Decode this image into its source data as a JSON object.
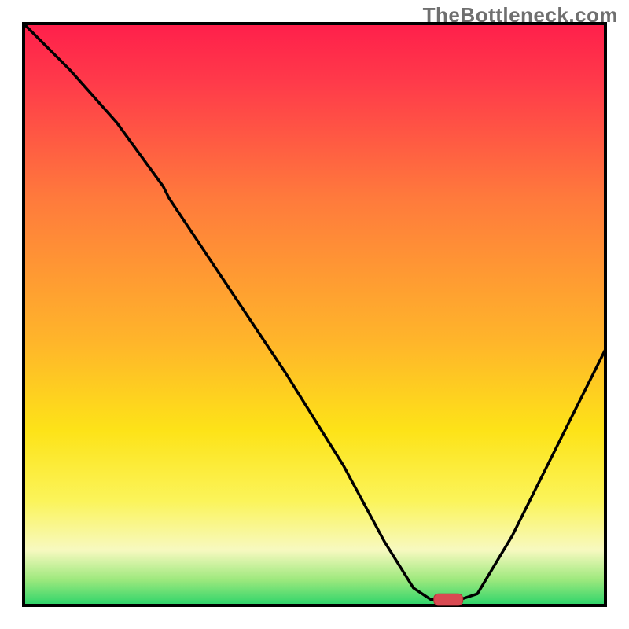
{
  "watermark": "TheBottleneck.com",
  "colors": {
    "gradient_top": "#ff1f4b",
    "gradient_mid": "#fde318",
    "gradient_bottom": "#2bd46a",
    "curve": "#000000",
    "marker": "#d94a52"
  },
  "chart_data": {
    "type": "line",
    "title": "",
    "xlabel": "",
    "ylabel": "",
    "xlim": [
      0,
      100
    ],
    "ylim": [
      0,
      100
    ],
    "note": "y is bottleneck percentage (0 = ideal at bottom, 100 = worst at top); x is relative component scale. Values estimated from gradient & curve position.",
    "curve": [
      {
        "x": 0,
        "y": 100
      },
      {
        "x": 8,
        "y": 92
      },
      {
        "x": 16,
        "y": 83
      },
      {
        "x": 24,
        "y": 72
      },
      {
        "x": 25,
        "y": 70
      },
      {
        "x": 35,
        "y": 55
      },
      {
        "x": 45,
        "y": 40
      },
      {
        "x": 55,
        "y": 24
      },
      {
        "x": 62,
        "y": 11
      },
      {
        "x": 67,
        "y": 3
      },
      {
        "x": 70,
        "y": 1
      },
      {
        "x": 75,
        "y": 1
      },
      {
        "x": 78,
        "y": 2
      },
      {
        "x": 84,
        "y": 12
      },
      {
        "x": 90,
        "y": 24
      },
      {
        "x": 96,
        "y": 36
      },
      {
        "x": 100,
        "y": 44
      }
    ],
    "inflection_at": {
      "x": 25,
      "y": 70
    },
    "marker": {
      "x": 73,
      "y": 1,
      "width_units": 5,
      "height_units": 2
    },
    "optimal_x": 73
  }
}
